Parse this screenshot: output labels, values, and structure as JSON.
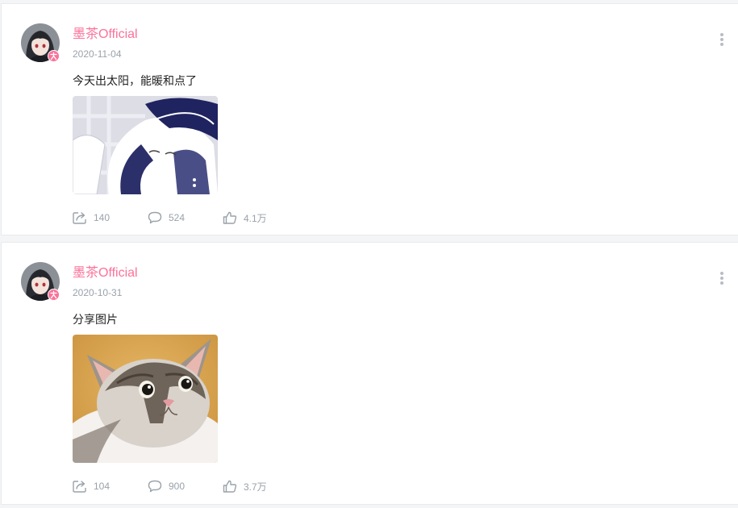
{
  "posts": [
    {
      "author": "墨茶Official",
      "date": "2020-11-04",
      "text": "今天出太阳，能暖和点了",
      "actions": {
        "repost": "140",
        "comment": "524",
        "like": "4.1万"
      },
      "image_icon": "sleeping-anime-girl-image"
    },
    {
      "author": "墨茶Official",
      "date": "2020-10-31",
      "text": "分享图片",
      "actions": {
        "repost": "104",
        "comment": "900",
        "like": "3.7万"
      },
      "image_icon": "shocked-cat-image"
    }
  ],
  "colors": {
    "author": "#fb7299",
    "meta": "#99a2aa",
    "text": "#222222",
    "badge": "#fb7299"
  }
}
